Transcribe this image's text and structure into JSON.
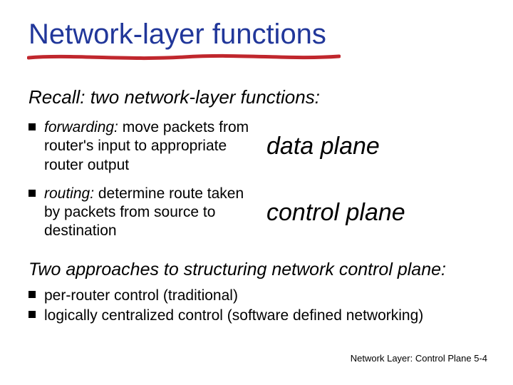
{
  "title": "Network-layer functions",
  "recall": "Recall: two network-layer functions:",
  "bullets": [
    {
      "lead": "forwarding:",
      "rest": " move packets from router's input to appropriate router output",
      "plane": "data plane"
    },
    {
      "lead": "routing:",
      "rest": " determine route taken by packets from source to destination",
      "plane": "control plane"
    }
  ],
  "approaches_heading": "Two approaches to structuring network control plane:",
  "approaches": [
    "per-router control (traditional)",
    "logically centralized control (software defined networking)"
  ],
  "footer": "Network Layer: Control Plane  5-4"
}
